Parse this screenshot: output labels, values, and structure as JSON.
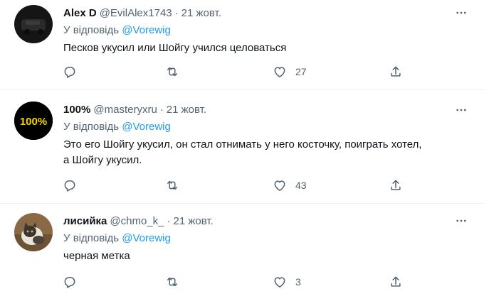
{
  "tweets": [
    {
      "name": "Alex D",
      "handle": "@EvilAlex1743",
      "dot": "·",
      "time": "21 жовт.",
      "reply_prefix": "У відповідь ",
      "reply_to": "@Vorewig",
      "text_lines": [
        "Песков укусил или Шойгу учился целоваться"
      ],
      "likes": "27",
      "avatar_icon": "dark-photo-avatar"
    },
    {
      "name": "100%",
      "handle": "@masteryxru",
      "dot": "·",
      "time": "21 жовт.",
      "reply_prefix": "У відповідь ",
      "reply_to": "@Vorewig",
      "text_lines": [
        "Это его Шойгу укусил, он стал отнимать у него косточку, поиграть хотел,",
        "а Шойгу укусил."
      ],
      "likes": "43",
      "avatar_label": "100%",
      "avatar_color": "#f4d400"
    },
    {
      "name": "лисийка",
      "handle": "@chmo_k_",
      "dot": "·",
      "time": "21 жовт.",
      "reply_prefix": "У відповідь ",
      "reply_to": "@Vorewig",
      "text_lines": [
        "черная метка"
      ],
      "likes": "3",
      "avatar_icon": "cat-photo-avatar"
    }
  ],
  "colors": {
    "link": "#1d9bf0",
    "muted": "#536471",
    "text": "#0f1419",
    "divider": "#eff3f4"
  },
  "icons": [
    "more-icon",
    "reply-icon",
    "retweet-icon",
    "like-icon",
    "share-icon"
  ]
}
